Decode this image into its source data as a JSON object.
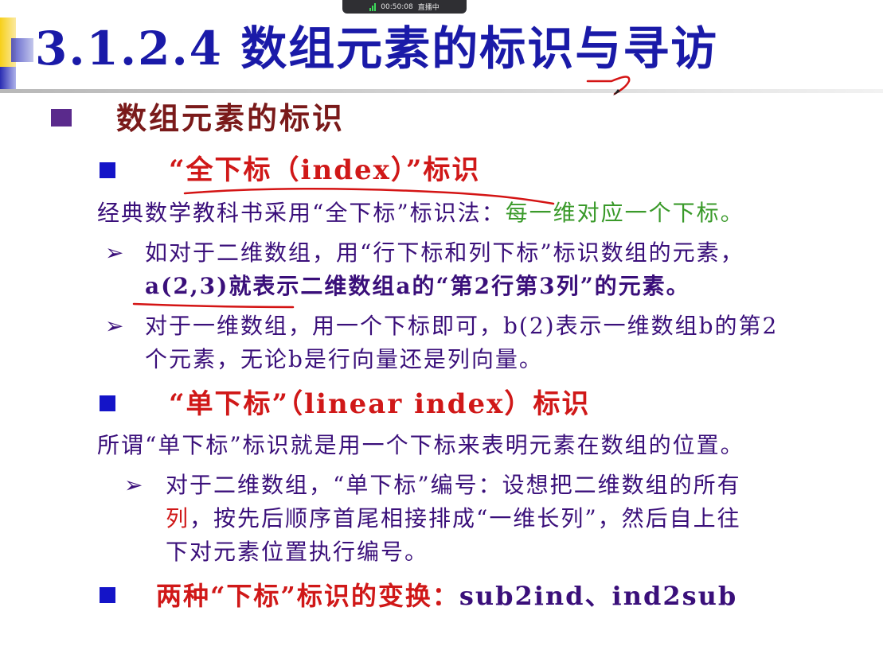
{
  "stream": {
    "timer": "00:50:08",
    "status": "直播中"
  },
  "title": "3.1.2.4  数组元素的标识与寻访",
  "section1": {
    "heading": "数组元素的标识",
    "sub1": {
      "heading": "“全下标（index）”标识",
      "line_prefix": "经典数学教科书采用“全下标”标识法：",
      "line_green": "每一维对应一个下标。",
      "items": [
        {
          "line1": "如对于二维数组，用“行下标和列下标”标识数组的元素，",
          "line2": "a(2,3)就表示二维数组a的“第2行第3列”的元素。"
        },
        {
          "line1": "对于一维数组，用一个下标即可，b(2)表示一维数组b的第2",
          "line2": "个元素，无论b是行向量还是列向量。"
        }
      ]
    },
    "sub2": {
      "heading": "“单下标”（linear index）标识",
      "line": "所谓“单下标”标识就是用一个下标来表明元素在数组的位置。",
      "item": {
        "line1": "对于二维数组，“单下标”编号：设想把二维数组的所有",
        "line2_red": "列",
        "line2_rest": "，按先后顺序首尾相接排成“一维长列”，然后自上往",
        "line3": "下对元素位置执行编号。"
      }
    },
    "sub3": {
      "heading_red": "两种“下标”标识的变换：",
      "heading_dark": "sub2ind、ind2sub"
    }
  },
  "colors": {
    "title": "#1a1aa8",
    "heading1": "#7a1a1a",
    "subheading": "#d01818",
    "body": "#3a0f7a",
    "highlight": "#3a9a2a"
  }
}
